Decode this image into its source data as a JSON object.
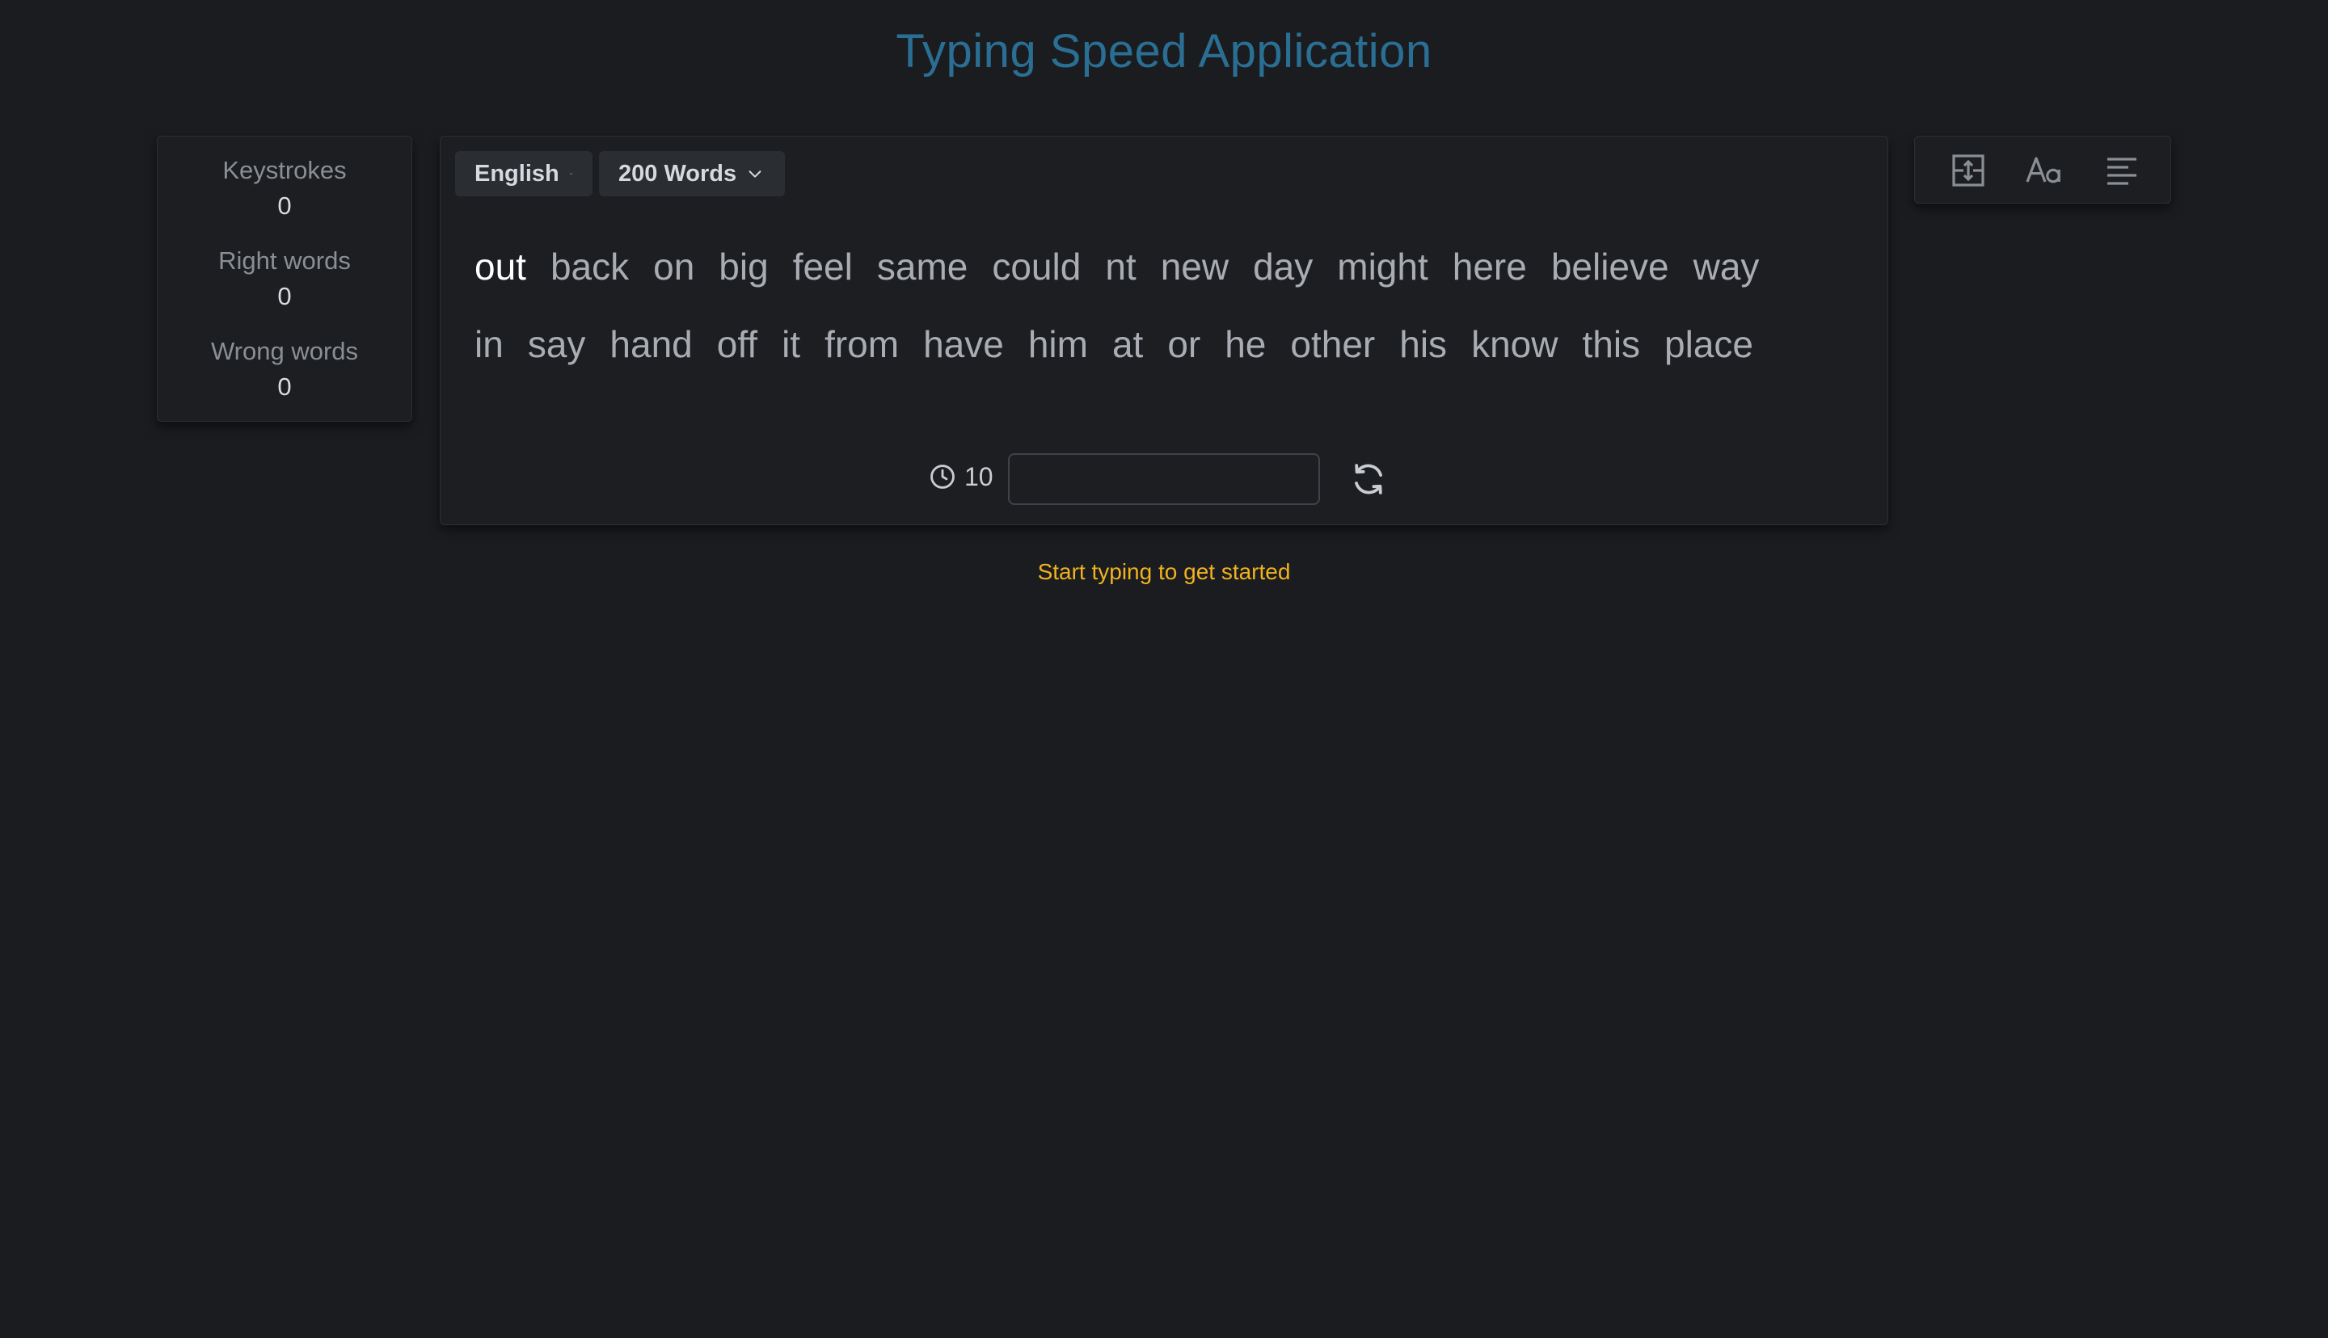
{
  "app": {
    "title": "Typing Speed Application"
  },
  "stats": {
    "keystrokes_label": "Keystrokes",
    "keystrokes_value": "0",
    "right_label": "Right words",
    "right_value": "0",
    "wrong_label": "Wrong words",
    "wrong_value": "0"
  },
  "controls": {
    "language": "English",
    "word_count": "200 Words"
  },
  "words": {
    "line1": [
      "out",
      "back",
      "on",
      "big",
      "feel",
      "same",
      "could",
      "nt",
      "new",
      "day",
      "might",
      "here",
      "believe",
      "way"
    ],
    "line2": [
      "in",
      "say",
      "hand",
      "off",
      "it",
      "from",
      "have",
      "him",
      "at",
      "or",
      "he",
      "other",
      "his",
      "know",
      "this",
      "place"
    ],
    "active_index": 0
  },
  "timer": {
    "seconds": "10"
  },
  "input": {
    "value": "",
    "placeholder": ""
  },
  "hint": "Start typing to get started",
  "icons": {
    "timer": "clock-icon",
    "restart": "refresh-icon",
    "tool1": "fit-box-icon",
    "tool2": "font-size-icon",
    "tool3": "text-align-left-icon"
  },
  "colors": {
    "background": "#1a1c1f",
    "title": "#2a6f93",
    "hint": "#f0b21f",
    "active_word": "#ffffff",
    "word": "#a9adb3"
  }
}
